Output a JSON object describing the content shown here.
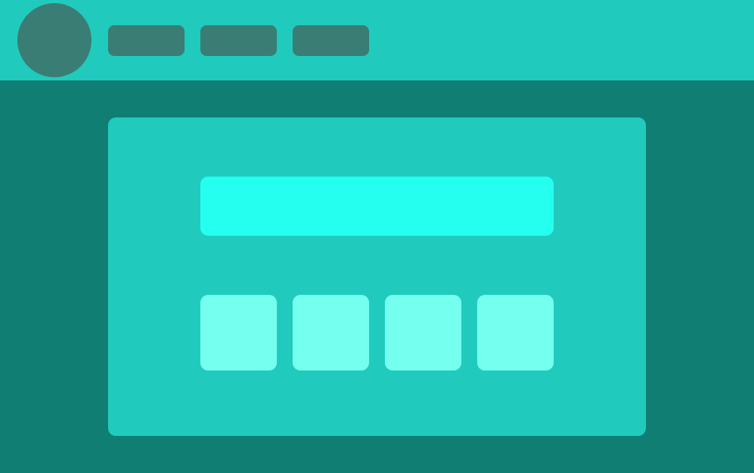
{
  "colors": {
    "background": "#117e73",
    "topbar": "#20cbbd",
    "avatar": "#3a7d74",
    "nav_pill": "#3a7d74",
    "card": "#20cbbd",
    "hero_field": "#24fff0",
    "tile": "#74ffef"
  },
  "header": {
    "avatar": {
      "label": ""
    },
    "nav_items": [
      {
        "label": ""
      },
      {
        "label": ""
      },
      {
        "label": ""
      }
    ]
  },
  "main": {
    "hero_field": {
      "value": "",
      "placeholder": ""
    },
    "tiles": [
      {
        "label": ""
      },
      {
        "label": ""
      },
      {
        "label": ""
      },
      {
        "label": ""
      }
    ]
  }
}
